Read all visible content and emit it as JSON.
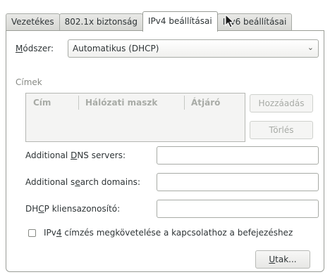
{
  "tabs": [
    {
      "label": "Vezetékes"
    },
    {
      "label": "802.1x biztonság"
    },
    {
      "label": "IPv4 beállításai",
      "active": true
    },
    {
      "label": "IPv6 beállításai"
    }
  ],
  "method": {
    "label_prefix": "",
    "label_mnemonic": "M",
    "label_rest": "ódszer:",
    "value": "Automatikus (DHCP)"
  },
  "addresses": {
    "section_title": "Címek",
    "columns": [
      "Cím",
      "Hálózati maszk",
      "Átjáró"
    ],
    "add_button": "Hozzáadás",
    "delete_button": "Törlés"
  },
  "dns": {
    "pre": "Additional ",
    "mn": "D",
    "post": "NS servers:",
    "value": ""
  },
  "search": {
    "pre": "Additional s",
    "mn": "e",
    "post": "arch domains:",
    "value": ""
  },
  "dhcp_client": {
    "pre": "DH",
    "mn": "C",
    "post": "P kliensazonosító:",
    "value": ""
  },
  "require_ipv4": {
    "pre": "IPv",
    "mn": "4",
    "post": " címzés megkövetelése a kapcsolathoz a befejezéshez",
    "checked": false
  },
  "routes_button": {
    "mn": "U",
    "rest": "tak..."
  }
}
